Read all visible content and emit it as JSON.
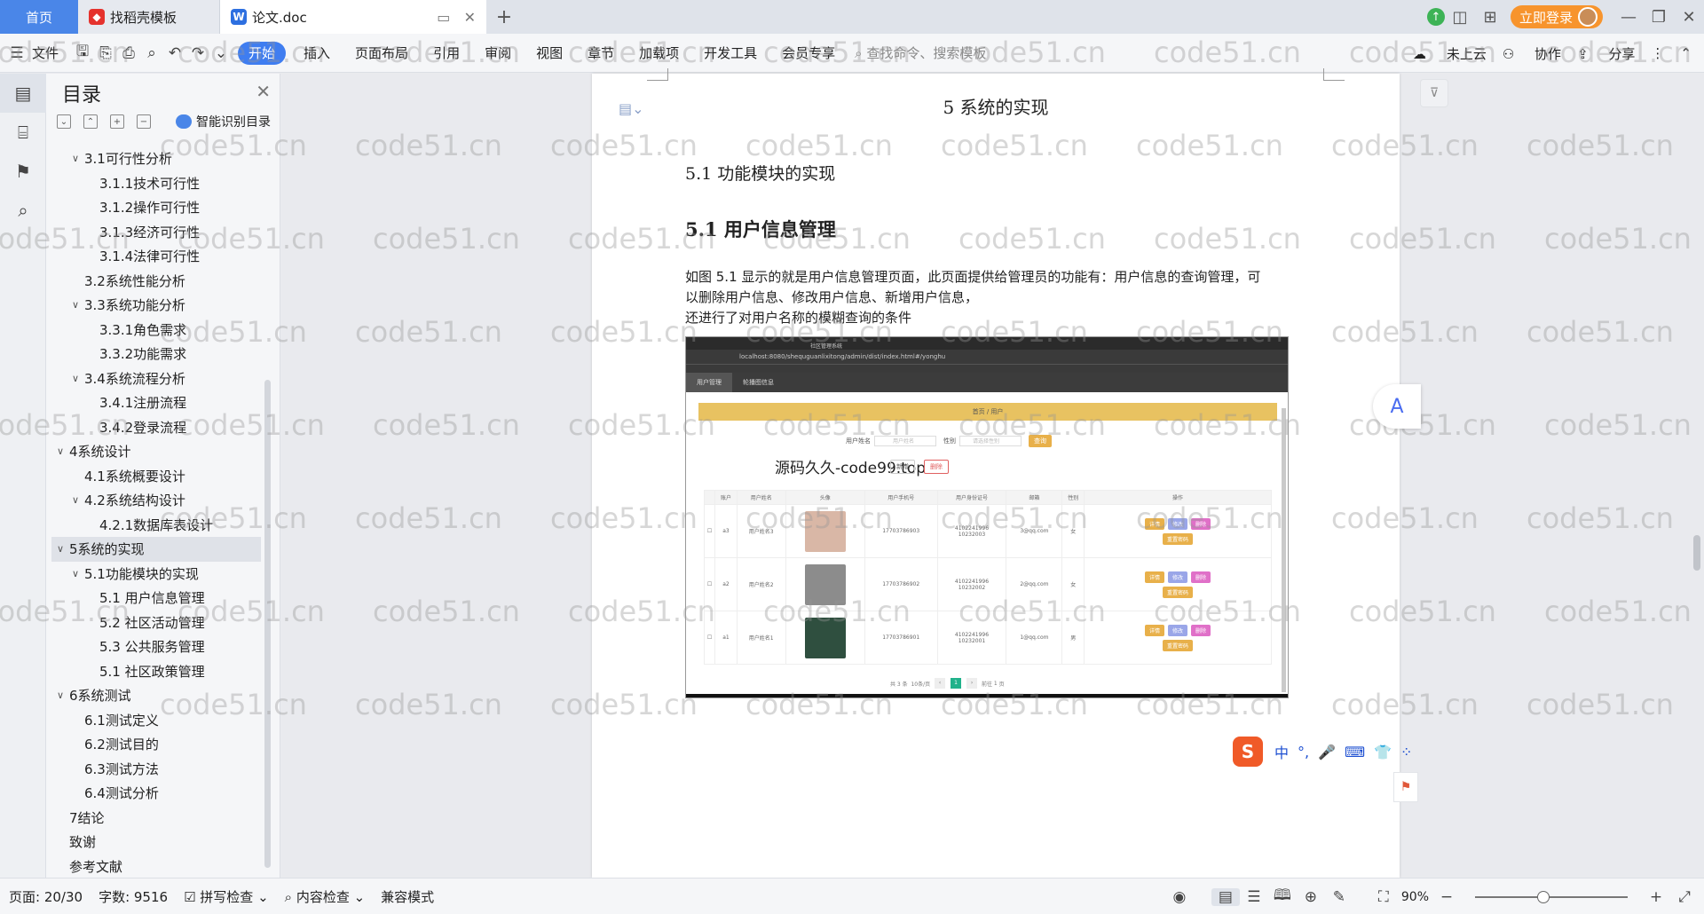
{
  "titlebar": {
    "tabs": [
      {
        "label": "首页"
      },
      {
        "label": "找稻壳模板"
      },
      {
        "label": "论文.doc"
      }
    ],
    "login_label": "立即登录"
  },
  "ribbon": {
    "file_label": "文件",
    "menu": [
      "开始",
      "插入",
      "页面布局",
      "引用",
      "审阅",
      "视图",
      "章节",
      "加载项",
      "开发工具",
      "会员专享"
    ],
    "search_placeholder": "查找命令、搜索模板",
    "right": [
      "未上云",
      "协作",
      "分享"
    ]
  },
  "toc": {
    "title": "目录",
    "smart_label": "智能识别目录",
    "items": [
      {
        "label": "3.1可行性分析",
        "level": 2,
        "arrow": "v"
      },
      {
        "label": "3.1.1技术可行性",
        "level": 3,
        "arrow": ""
      },
      {
        "label": "3.1.2操作可行性",
        "level": 3,
        "arrow": ""
      },
      {
        "label": "3.1.3经济可行性",
        "level": 3,
        "arrow": ""
      },
      {
        "label": "3.1.4法律可行性",
        "level": 3,
        "arrow": ""
      },
      {
        "label": "3.2系统性能分析",
        "level": 2,
        "arrow": ""
      },
      {
        "label": "3.3系统功能分析",
        "level": 2,
        "arrow": "v"
      },
      {
        "label": "3.3.1角色需求",
        "level": 3,
        "arrow": ""
      },
      {
        "label": "3.3.2功能需求",
        "level": 3,
        "arrow": ""
      },
      {
        "label": "3.4系统流程分析",
        "level": 2,
        "arrow": "v"
      },
      {
        "label": "3.4.1注册流程",
        "level": 3,
        "arrow": ""
      },
      {
        "label": "3.4.2登录流程",
        "level": 3,
        "arrow": ""
      },
      {
        "label": "4系统设计",
        "level": 1,
        "arrow": "v"
      },
      {
        "label": "4.1系统概要设计",
        "level": 2,
        "arrow": ""
      },
      {
        "label": "4.2系统结构设计",
        "level": 2,
        "arrow": "v"
      },
      {
        "label": "4.2.1数据库表设计",
        "level": 3,
        "arrow": ""
      },
      {
        "label": "5系统的实现",
        "level": 1,
        "arrow": "v",
        "selected": true
      },
      {
        "label": "5.1功能模块的实现",
        "level": 2,
        "arrow": "v"
      },
      {
        "label": "5.1 用户信息管理",
        "level": 3,
        "arrow": ""
      },
      {
        "label": "5.2 社区活动管理",
        "level": 3,
        "arrow": ""
      },
      {
        "label": "5.3 公共服务管理",
        "level": 3,
        "arrow": ""
      },
      {
        "label": "5.1 社区政策管理",
        "level": 3,
        "arrow": ""
      },
      {
        "label": "6系统测试",
        "level": 1,
        "arrow": "v"
      },
      {
        "label": "6.1测试定义",
        "level": 2,
        "arrow": ""
      },
      {
        "label": "6.2测试目的",
        "level": 2,
        "arrow": ""
      },
      {
        "label": "6.3测试方法",
        "level": 2,
        "arrow": ""
      },
      {
        "label": "6.4测试分析",
        "level": 2,
        "arrow": ""
      },
      {
        "label": "7结论",
        "level": 1,
        "arrow": ""
      },
      {
        "label": "致谢",
        "level": 1,
        "arrow": ""
      },
      {
        "label": "参考文献",
        "level": 1,
        "arrow": ""
      }
    ]
  },
  "document": {
    "heading1": "5  系统的实现",
    "heading2": "5.1  功能模块的实现",
    "heading3": "5.1 用户信息管理",
    "paragraph_lines": [
      "如图 5.1 显示的就是用户信息管理页面，此页面提供给管理员的功能有：用户信息的查询管理，可",
      "以删除用户信息、修改用户信息、新增用户信息，",
      "还进行了对用户名称的模糊查询的条件"
    ],
    "screenshot": {
      "tab_text": "社区管理系统",
      "url": "localhost:8080/shequguanlixitong/admin/dist/index.html#/yonghu",
      "nav_items": [
        "用户管理",
        "轮播图信息"
      ],
      "breadcrumb": "首页 / 用户",
      "search_labels": [
        "用户姓名",
        "性别"
      ],
      "search_placeholders": [
        "用户姓名",
        "请选择性别"
      ],
      "query_button": "查询",
      "watermark": "源码久久-code99.top",
      "add_button": "新增",
      "delete_button": "删除",
      "columns": [
        "",
        "账户",
        "用户姓名",
        "头像",
        "用户手机号",
        "用户身份证号",
        "邮箱",
        "性别",
        "操作"
      ],
      "rows": [
        [
          "a3",
          "用户姓名3",
          "17703786903",
          "410224199610232003",
          "3@qq.com",
          "女"
        ],
        [
          "a2",
          "用户姓名2",
          "17703786902",
          "410224199610232002",
          "2@qq.com",
          "女"
        ],
        [
          "a1",
          "用户姓名1",
          "17703786901",
          "410224199610232001",
          "1@qq.com",
          "男"
        ]
      ],
      "row_actions": [
        "详情",
        "修改",
        "删除",
        "重置密码"
      ],
      "pager": {
        "total": "共 3 条",
        "page_size": "10条/页",
        "current": "1",
        "goto": "前往",
        "goto_page": "1",
        "page_unit": "页"
      }
    }
  },
  "watermark_text": "code51.cn",
  "ime": {
    "labels": [
      "中",
      "°,",
      "🎤",
      "⌨",
      "👕",
      "⁘"
    ]
  },
  "status": {
    "page": "页面: 20/30",
    "words": "字数: 9516",
    "spell": "拼写检查",
    "content_check": "内容检查",
    "compat": "兼容模式",
    "zoom": "90%"
  }
}
